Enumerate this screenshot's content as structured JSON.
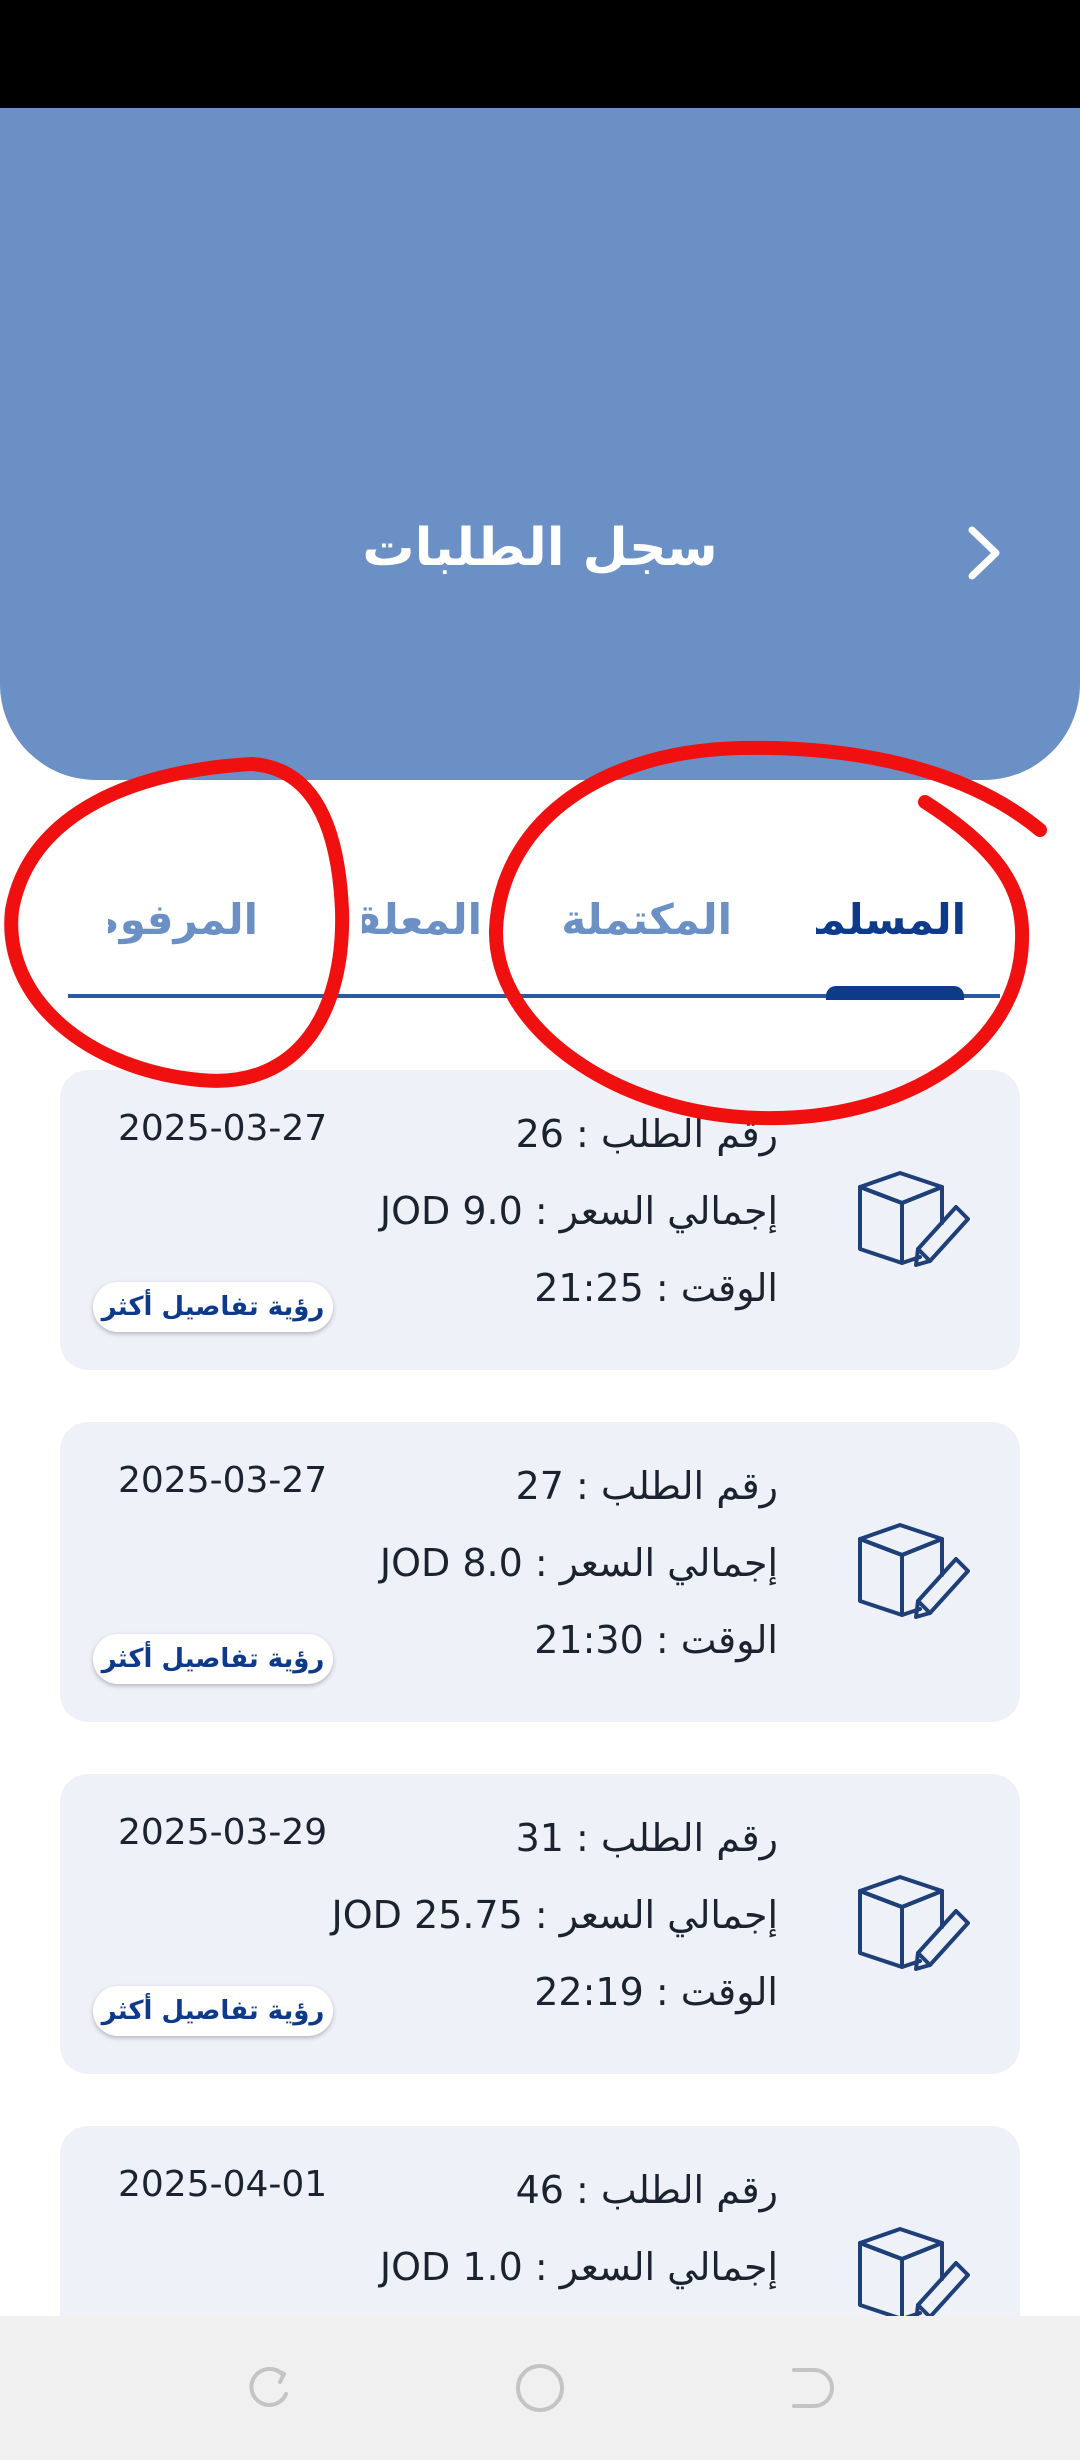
{
  "header": {
    "title": "سجل الطلبات",
    "back_icon": "chevron-right-icon"
  },
  "tabs": [
    {
      "label": "المسلمة",
      "active": true
    },
    {
      "label": "المكتملة",
      "active": false
    },
    {
      "label": "المعلقة",
      "active": false
    },
    {
      "label": "المرفوضة",
      "active": false
    }
  ],
  "orders": [
    {
      "order_label": "رقم الطلب :",
      "order_no": "26",
      "total_label": "إجمالي السعر :",
      "total": "JOD 9.0",
      "time_label": "الوقت :",
      "time": "21:25",
      "date": "2025-03-27",
      "details_label": "رؤية تفاصيل أكثر"
    },
    {
      "order_label": "رقم الطلب :",
      "order_no": "27",
      "total_label": "إجمالي السعر :",
      "total": "JOD 8.0",
      "time_label": "الوقت :",
      "time": "21:30",
      "date": "2025-03-27",
      "details_label": "رؤية تفاصيل أكثر"
    },
    {
      "order_label": "رقم الطلب :",
      "order_no": "31",
      "total_label": "إجمالي السعر :",
      "total": "JOD 25.75",
      "time_label": "الوقت :",
      "time": "22:19",
      "date": "2025-03-29",
      "details_label": "رؤية تفاصيل أكثر"
    },
    {
      "order_label": "رقم الطلب :",
      "order_no": "46",
      "total_label": "إجمالي السعر :",
      "total": "JOD 1.0",
      "time_label": "",
      "time": "",
      "date": "2025-04-01",
      "details_label": ""
    }
  ],
  "colors": {
    "header": "#6a90c6",
    "accent": "#0d3a8a",
    "tab_inactive": "#6a90c6",
    "card": "#eef2f8",
    "annotation": "#f01010"
  },
  "nav": {
    "recent_icon": "recent-apps-icon",
    "home_icon": "home-icon",
    "back_icon": "back-icon"
  }
}
